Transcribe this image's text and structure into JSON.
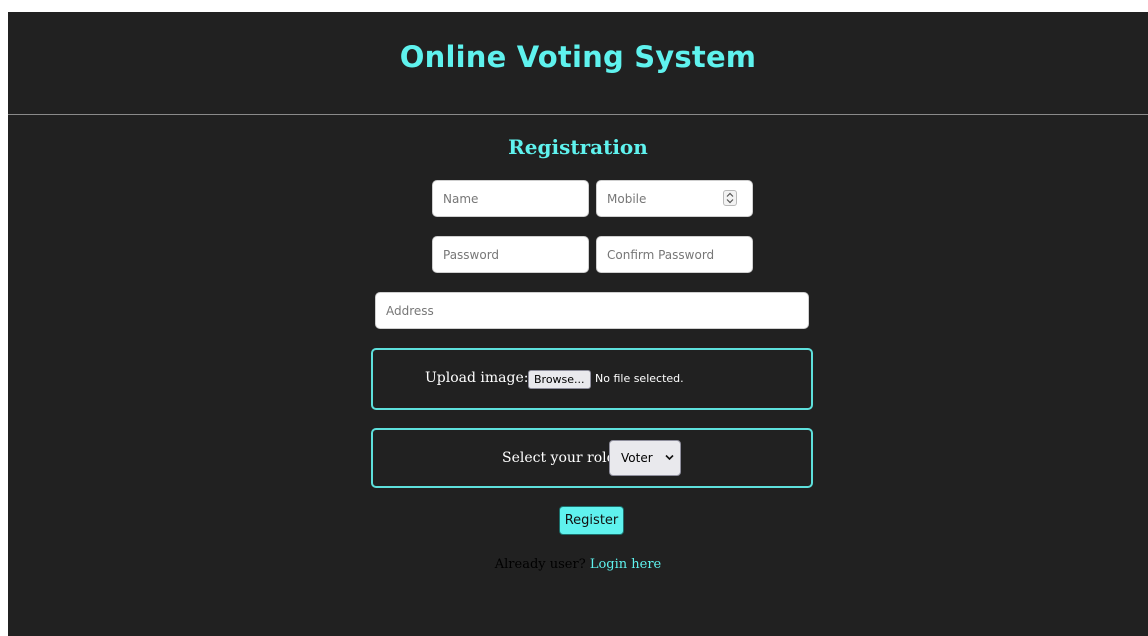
{
  "header": {
    "title": "Online Voting System"
  },
  "registration": {
    "title": "Registration",
    "fields": {
      "name": {
        "placeholder": "Name",
        "value": ""
      },
      "mobile": {
        "placeholder": "Mobile",
        "value": ""
      },
      "password": {
        "placeholder": "Password",
        "value": ""
      },
      "confirm_password": {
        "placeholder": "Confirm Password",
        "value": ""
      },
      "address": {
        "placeholder": "Address",
        "value": ""
      }
    },
    "upload": {
      "label": "Upload image:",
      "browse_label": "Browse...",
      "status": "No file selected."
    },
    "role": {
      "label": "Select your role:",
      "selected": "Voter"
    },
    "register_label": "Register",
    "login_prompt": "Already user?",
    "login_link": "Login here"
  },
  "icons": {
    "spinner": "up-down-spinner-icon",
    "select_arrow": "chevron-down-icon"
  },
  "colors": {
    "accent": "#5ff2ee",
    "background": "#212121",
    "panel_border": "#5ee0dc"
  }
}
